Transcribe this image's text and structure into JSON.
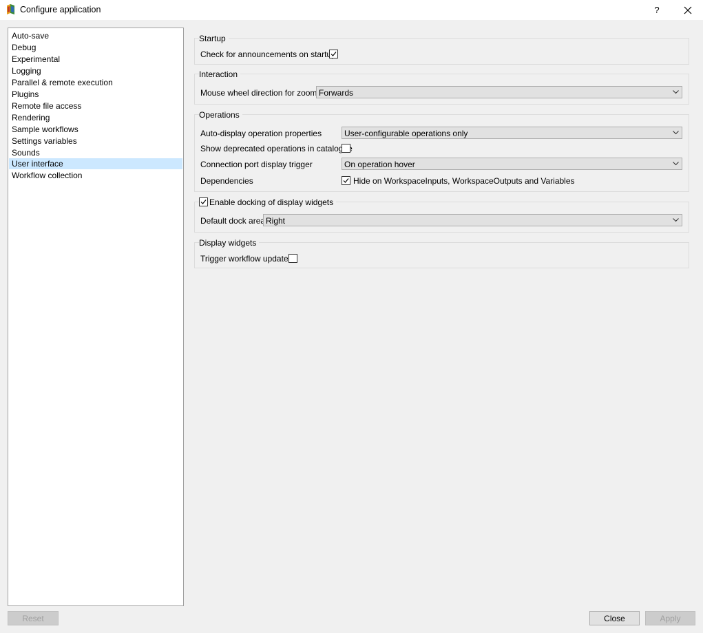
{
  "window": {
    "title": "Configure application",
    "help_label": "?"
  },
  "sidebar": {
    "items": [
      {
        "label": "Auto-save"
      },
      {
        "label": "Debug"
      },
      {
        "label": "Experimental"
      },
      {
        "label": "Logging"
      },
      {
        "label": "Parallel & remote execution"
      },
      {
        "label": "Plugins"
      },
      {
        "label": "Remote file access"
      },
      {
        "label": "Rendering"
      },
      {
        "label": "Sample workflows"
      },
      {
        "label": "Settings variables"
      },
      {
        "label": "Sounds"
      },
      {
        "label": "User interface"
      },
      {
        "label": "Workflow collection"
      }
    ],
    "selected": "User interface"
  },
  "startup": {
    "title": "Startup",
    "check_announcements_label": "Check for announcements  on startup",
    "check_announcements_checked": true
  },
  "interaction": {
    "title": "Interaction",
    "mouse_wheel_label": "Mouse wheel direction for zoom in",
    "mouse_wheel_value": "Forwards"
  },
  "operations": {
    "title": "Operations",
    "auto_display_label": "Auto-display operation properties",
    "auto_display_value": "User-configurable operations only",
    "show_deprecated_label": "Show deprecated operations in catalogue",
    "show_deprecated_checked": false,
    "connection_port_label": "Connection port display trigger",
    "connection_port_value": "On operation hover",
    "dependencies_label": "Dependencies",
    "hide_on_label": "Hide on WorkspaceInputs, WorkspaceOutputs and Variables",
    "hide_on_checked": true
  },
  "docking": {
    "enable_label": "Enable docking of display widgets",
    "enable_checked": true,
    "default_dock_label": "Default dock area",
    "default_dock_value": "Right"
  },
  "display_widgets": {
    "title": "Display widgets",
    "trigger_label": "Trigger workflow updates",
    "trigger_checked": false
  },
  "footer": {
    "reset_label": "Reset",
    "close_label": "Close",
    "apply_label": "Apply"
  }
}
